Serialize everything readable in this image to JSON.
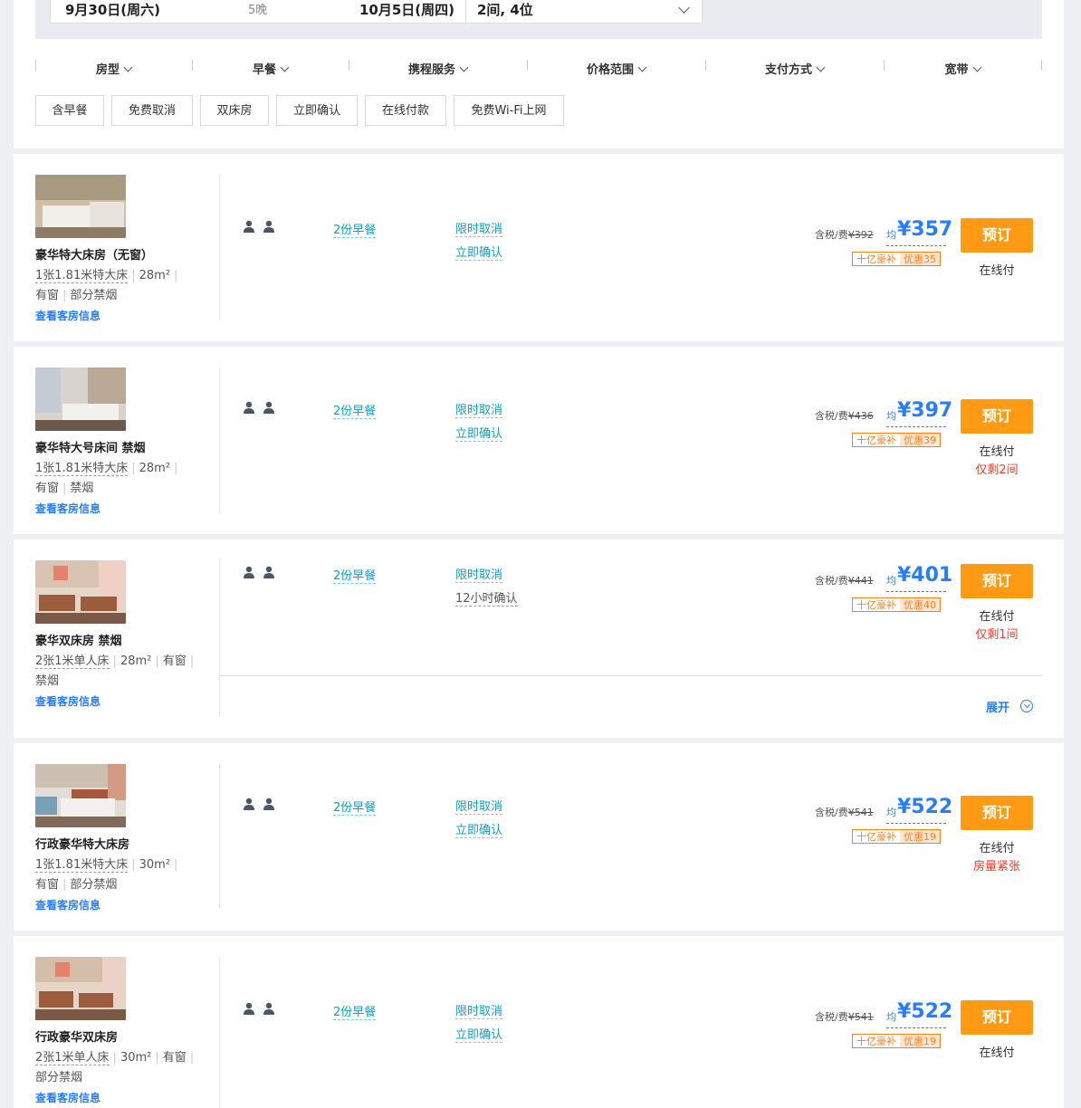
{
  "search": {
    "checkin": "9月30日(周六)",
    "nights": "5晚",
    "checkout": "10月5日(周四)",
    "rooms_guests": "2间, 4位"
  },
  "filters": [
    "房型",
    "早餐",
    "携程服务",
    "价格范围",
    "支付方式",
    "宽带"
  ],
  "tags": [
    "含早餐",
    "免费取消",
    "双床房",
    "立即确认",
    "在线付款",
    "免费Wi-Fi上网"
  ],
  "rooms": [
    {
      "name": "豪华特大床房（无窗）",
      "line1": [
        "1张1.81米特大床",
        "28m²",
        ""
      ],
      "line2": [
        "有窗",
        "部分禁烟"
      ],
      "link": "查看客房信息",
      "breakfast": "2份早餐",
      "cancel": "限时取消",
      "confirm": "立即确认",
      "tax_label": "含税/费",
      "orig_price": "¥392",
      "avg": "均",
      "price": "¥357",
      "promo_a": "十亿豪补",
      "promo_b": "优惠35",
      "book": "预订",
      "pay": "在线付",
      "remain": ""
    },
    {
      "name": "豪华特大号床间 禁烟",
      "line1": [
        "1张1.81米特大床",
        "28m²",
        ""
      ],
      "line2": [
        "有窗",
        "禁烟"
      ],
      "link": "查看客房信息",
      "breakfast": "2份早餐",
      "cancel": "限时取消",
      "confirm": "立即确认",
      "tax_label": "含税/费",
      "orig_price": "¥436",
      "avg": "均",
      "price": "¥397",
      "promo_a": "十亿豪补",
      "promo_b": "优惠39",
      "book": "预订",
      "pay": "在线付",
      "remain": "仅剩2间"
    },
    {
      "name": "豪华双床房 禁烟",
      "line1": [
        "2张1米单人床",
        "28m²",
        "有窗",
        ""
      ],
      "line2": [
        "禁烟"
      ],
      "link": "查看客房信息",
      "breakfast": "2份早餐",
      "cancel": "限时取消",
      "confirm": "12小时确认",
      "tax_label": "含税/费",
      "orig_price": "¥441",
      "avg": "均",
      "price": "¥401",
      "promo_a": "十亿豪补",
      "promo_b": "优惠40",
      "book": "预订",
      "pay": "在线付",
      "remain": "仅剩1间",
      "expand": "展开"
    },
    {
      "name": "行政豪华特大床房",
      "line1": [
        "1张1.81米特大床",
        "30m²",
        ""
      ],
      "line2": [
        "有窗",
        "部分禁烟"
      ],
      "link": "查看客房信息",
      "breakfast": "2份早餐",
      "cancel": "限时取消",
      "confirm": "立即确认",
      "tax_label": "含税/费",
      "orig_price": "¥541",
      "avg": "均",
      "price": "¥522",
      "promo_a": "十亿豪补",
      "promo_b": "优惠19",
      "book": "预订",
      "pay": "在线付",
      "remain": "房量紧张"
    },
    {
      "name": "行政豪华双床房",
      "line1": [
        "2张1米单人床",
        "30m²",
        "有窗",
        ""
      ],
      "line2": [
        "部分禁烟"
      ],
      "link": "查看客房信息",
      "breakfast": "2份早餐",
      "cancel": "限时取消",
      "confirm": "立即确认",
      "tax_label": "含税/费",
      "orig_price": "¥541",
      "avg": "均",
      "price": "¥522",
      "promo_a": "十亿豪补",
      "promo_b": "优惠19",
      "book": "预订",
      "pay": "在线付",
      "remain": ""
    }
  ],
  "colors": {
    "accent_blue": "#287dfa",
    "book_orange": "#ff9a14",
    "promo_orange": "#ff7d13",
    "link_teal": "#0aa0c0",
    "remain_red": "#ee3b28"
  },
  "icons": [
    "chevron-down-icon",
    "person-icon",
    "expand-circle-icon",
    "room-photo"
  ]
}
